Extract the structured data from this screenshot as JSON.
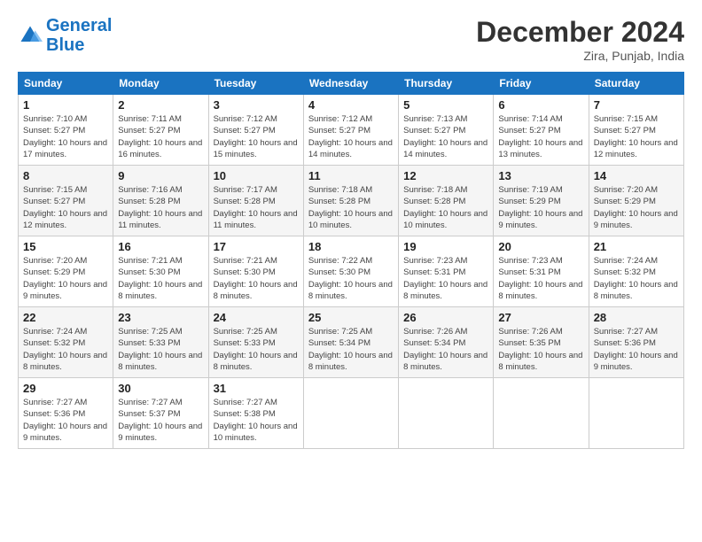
{
  "logo": {
    "line1": "General",
    "line2": "Blue"
  },
  "title": "December 2024",
  "location": "Zira, Punjab, India",
  "days_of_week": [
    "Sunday",
    "Monday",
    "Tuesday",
    "Wednesday",
    "Thursday",
    "Friday",
    "Saturday"
  ],
  "weeks": [
    [
      {
        "day": "1",
        "sunrise": "7:10 AM",
        "sunset": "5:27 PM",
        "daylight": "10 hours and 17 minutes."
      },
      {
        "day": "2",
        "sunrise": "7:11 AM",
        "sunset": "5:27 PM",
        "daylight": "10 hours and 16 minutes."
      },
      {
        "day": "3",
        "sunrise": "7:12 AM",
        "sunset": "5:27 PM",
        "daylight": "10 hours and 15 minutes."
      },
      {
        "day": "4",
        "sunrise": "7:12 AM",
        "sunset": "5:27 PM",
        "daylight": "10 hours and 14 minutes."
      },
      {
        "day": "5",
        "sunrise": "7:13 AM",
        "sunset": "5:27 PM",
        "daylight": "10 hours and 14 minutes."
      },
      {
        "day": "6",
        "sunrise": "7:14 AM",
        "sunset": "5:27 PM",
        "daylight": "10 hours and 13 minutes."
      },
      {
        "day": "7",
        "sunrise": "7:15 AM",
        "sunset": "5:27 PM",
        "daylight": "10 hours and 12 minutes."
      }
    ],
    [
      {
        "day": "8",
        "sunrise": "7:15 AM",
        "sunset": "5:27 PM",
        "daylight": "10 hours and 12 minutes."
      },
      {
        "day": "9",
        "sunrise": "7:16 AM",
        "sunset": "5:28 PM",
        "daylight": "10 hours and 11 minutes."
      },
      {
        "day": "10",
        "sunrise": "7:17 AM",
        "sunset": "5:28 PM",
        "daylight": "10 hours and 11 minutes."
      },
      {
        "day": "11",
        "sunrise": "7:18 AM",
        "sunset": "5:28 PM",
        "daylight": "10 hours and 10 minutes."
      },
      {
        "day": "12",
        "sunrise": "7:18 AM",
        "sunset": "5:28 PM",
        "daylight": "10 hours and 10 minutes."
      },
      {
        "day": "13",
        "sunrise": "7:19 AM",
        "sunset": "5:29 PM",
        "daylight": "10 hours and 9 minutes."
      },
      {
        "day": "14",
        "sunrise": "7:20 AM",
        "sunset": "5:29 PM",
        "daylight": "10 hours and 9 minutes."
      }
    ],
    [
      {
        "day": "15",
        "sunrise": "7:20 AM",
        "sunset": "5:29 PM",
        "daylight": "10 hours and 9 minutes."
      },
      {
        "day": "16",
        "sunrise": "7:21 AM",
        "sunset": "5:30 PM",
        "daylight": "10 hours and 8 minutes."
      },
      {
        "day": "17",
        "sunrise": "7:21 AM",
        "sunset": "5:30 PM",
        "daylight": "10 hours and 8 minutes."
      },
      {
        "day": "18",
        "sunrise": "7:22 AM",
        "sunset": "5:30 PM",
        "daylight": "10 hours and 8 minutes."
      },
      {
        "day": "19",
        "sunrise": "7:23 AM",
        "sunset": "5:31 PM",
        "daylight": "10 hours and 8 minutes."
      },
      {
        "day": "20",
        "sunrise": "7:23 AM",
        "sunset": "5:31 PM",
        "daylight": "10 hours and 8 minutes."
      },
      {
        "day": "21",
        "sunrise": "7:24 AM",
        "sunset": "5:32 PM",
        "daylight": "10 hours and 8 minutes."
      }
    ],
    [
      {
        "day": "22",
        "sunrise": "7:24 AM",
        "sunset": "5:32 PM",
        "daylight": "10 hours and 8 minutes."
      },
      {
        "day": "23",
        "sunrise": "7:25 AM",
        "sunset": "5:33 PM",
        "daylight": "10 hours and 8 minutes."
      },
      {
        "day": "24",
        "sunrise": "7:25 AM",
        "sunset": "5:33 PM",
        "daylight": "10 hours and 8 minutes."
      },
      {
        "day": "25",
        "sunrise": "7:25 AM",
        "sunset": "5:34 PM",
        "daylight": "10 hours and 8 minutes."
      },
      {
        "day": "26",
        "sunrise": "7:26 AM",
        "sunset": "5:34 PM",
        "daylight": "10 hours and 8 minutes."
      },
      {
        "day": "27",
        "sunrise": "7:26 AM",
        "sunset": "5:35 PM",
        "daylight": "10 hours and 8 minutes."
      },
      {
        "day": "28",
        "sunrise": "7:27 AM",
        "sunset": "5:36 PM",
        "daylight": "10 hours and 9 minutes."
      }
    ],
    [
      {
        "day": "29",
        "sunrise": "7:27 AM",
        "sunset": "5:36 PM",
        "daylight": "10 hours and 9 minutes."
      },
      {
        "day": "30",
        "sunrise": "7:27 AM",
        "sunset": "5:37 PM",
        "daylight": "10 hours and 9 minutes."
      },
      {
        "day": "31",
        "sunrise": "7:27 AM",
        "sunset": "5:38 PM",
        "daylight": "10 hours and 10 minutes."
      },
      null,
      null,
      null,
      null
    ]
  ],
  "labels": {
    "sunrise_prefix": "Sunrise: ",
    "sunset_prefix": "Sunset: ",
    "daylight_prefix": "Daylight: "
  }
}
